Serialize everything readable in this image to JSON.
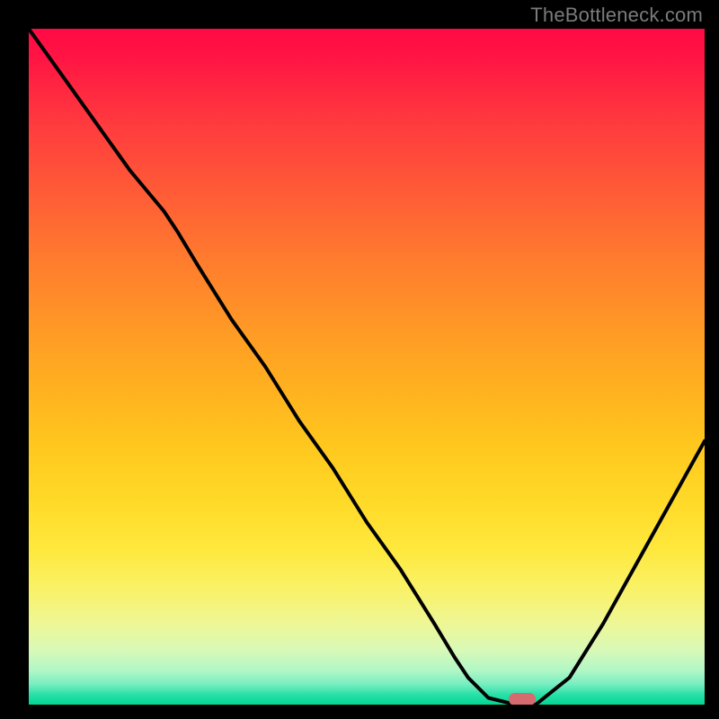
{
  "watermark": "TheBottleneck.com",
  "chart_data": {
    "type": "line",
    "title": "",
    "xlabel": "",
    "ylabel": "",
    "xlim": [
      0,
      100
    ],
    "ylim": [
      0,
      100
    ],
    "x": [
      0,
      5,
      10,
      15,
      20,
      22,
      25,
      30,
      35,
      40,
      45,
      50,
      55,
      60,
      63,
      65,
      68,
      72,
      75,
      80,
      85,
      90,
      95,
      100
    ],
    "values": [
      100,
      93,
      86,
      79,
      73,
      70,
      65,
      57,
      50,
      42,
      35,
      27,
      20,
      12,
      7,
      4,
      1,
      0,
      0,
      4,
      12,
      21,
      30,
      39
    ],
    "marker": {
      "x": 73,
      "y": 0.8
    },
    "gradient_stops": [
      {
        "pos": 0,
        "color": "#ff0a45"
      },
      {
        "pos": 0.25,
        "color": "#ff5e36"
      },
      {
        "pos": 0.5,
        "color": "#ffb31f"
      },
      {
        "pos": 0.75,
        "color": "#ffe83d"
      },
      {
        "pos": 0.9,
        "color": "#d8f9b8"
      },
      {
        "pos": 1.0,
        "color": "#00d794"
      }
    ]
  }
}
